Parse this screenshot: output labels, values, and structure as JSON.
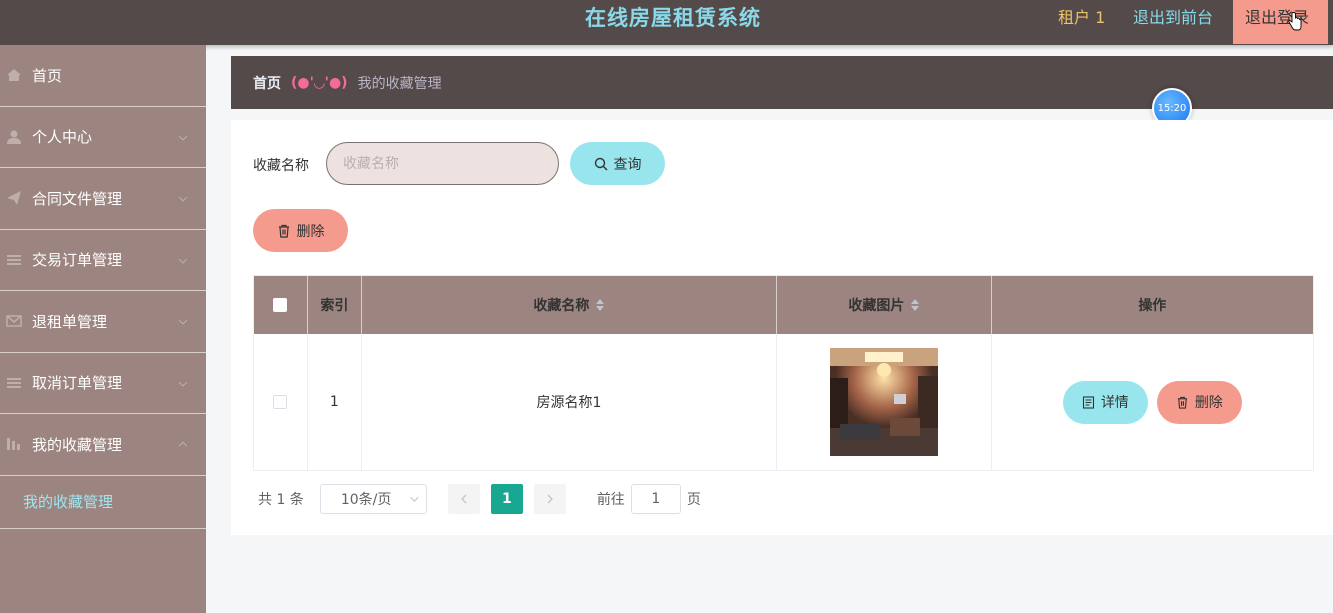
{
  "header": {
    "title": "在线房屋租赁系统",
    "user": "租户 1",
    "to_front": "退出到前台",
    "logout": "退出登录"
  },
  "sidebar": {
    "items": [
      {
        "label": "首页",
        "icon": "home-icon"
      },
      {
        "label": "个人中心",
        "icon": "user-icon"
      },
      {
        "label": "合同文件管理",
        "icon": "send-icon"
      },
      {
        "label": "交易订单管理",
        "icon": "list-icon"
      },
      {
        "label": "退租单管理",
        "icon": "mail-icon"
      },
      {
        "label": "取消订单管理",
        "icon": "list-icon"
      },
      {
        "label": "我的收藏管理",
        "icon": "chart-icon"
      }
    ],
    "submenu": {
      "label": "我的收藏管理"
    }
  },
  "breadcrumb": {
    "home": "首页",
    "face": "(●'◡'●)",
    "current": "我的收藏管理"
  },
  "clock": {
    "time": "15:20"
  },
  "search": {
    "label": "收藏名称",
    "placeholder": "收藏名称",
    "value": "",
    "query_label": "查询"
  },
  "actions": {
    "delete_label": "删除"
  },
  "table": {
    "headers": {
      "index": "索引",
      "name": "收藏名称",
      "image": "收藏图片",
      "operation": "操作"
    },
    "rows": [
      {
        "index": "1",
        "name": "房源名称1",
        "detail": "详情",
        "delete": "删除"
      }
    ]
  },
  "pagination": {
    "total": "共 1 条",
    "page_size": "10条/页",
    "current": "1",
    "goto_label": "前往",
    "goto_value": "1",
    "page_suffix": "页"
  },
  "colors": {
    "header_bg": "#544a49",
    "sidebar_bg": "#9c8581",
    "accent_cyan": "#98e5ee",
    "accent_salmon": "#f59b8e",
    "page_active": "#18a892"
  }
}
